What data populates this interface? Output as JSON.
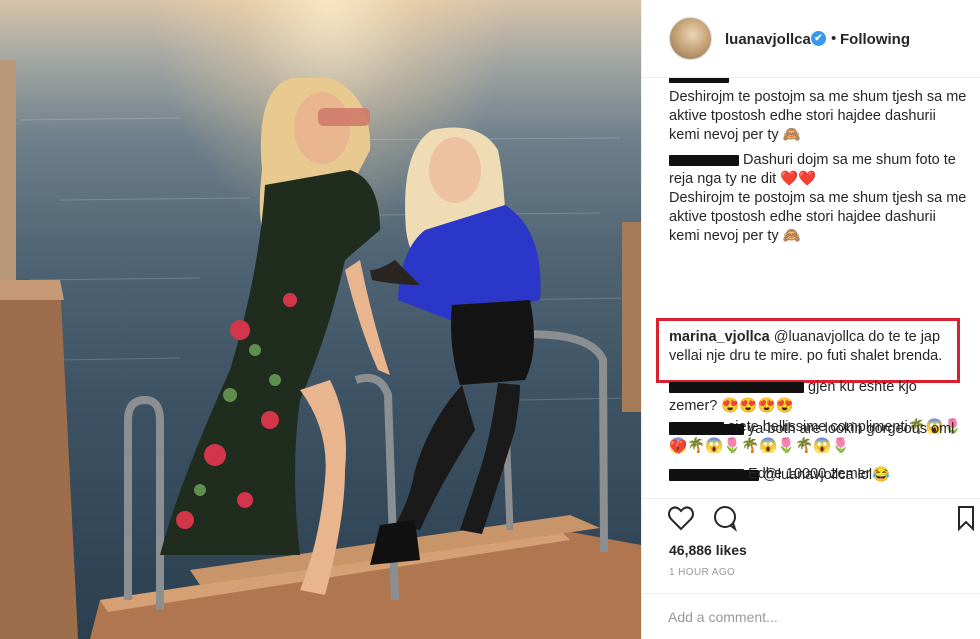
{
  "post": {
    "username": "luanavjollca",
    "verified_glyph": "✔",
    "dot": "•",
    "following_label": "Following"
  },
  "comments": [
    {
      "id": "c1",
      "user": "",
      "text": "Deshirojm te postojm sa me shum tjesh sa me aktive tpostosh edhe stori hajdee dashurii kemi nevoj per ty 🙈"
    },
    {
      "id": "c2",
      "user": "",
      "text": "Dashuri dojm sa me shum foto te reja nga ty ne dit ❤️❤️"
    },
    {
      "id": "c2b",
      "user": "",
      "text": "Deshirojm te postojm sa me shum tjesh sa me aktive tpostosh edhe stori hajdee dashurii kemi nevoj per ty 🙈"
    },
    {
      "id": "c3",
      "user": "marina_vjollca",
      "text": "@luanavjollca do te te jap vellai nje dru te mire. po futi shalet brenda."
    },
    {
      "id": "c4",
      "user": "",
      "text": "gjen ku eshte kjo zemer? 😍😍😍😍"
    },
    {
      "id": "c5",
      "user": "",
      "text": "siete bellissime complimenti🌴😱🌷 😱🌴😱🌷🌴😱🌷🌴😱🌷"
    },
    {
      "id": "c6",
      "user": "",
      "text": "@luanavjollca lol😂"
    },
    {
      "id": "c7",
      "user": "",
      "text": "ya both are lookin gorgeous oml💔"
    },
    {
      "id": "c8",
      "user": "",
      "text": "Edhe 10000 zemer"
    }
  ],
  "actions": {
    "likes": "46,886 likes",
    "time": "1 HOUR AGO",
    "add_comment_placeholder": "Add a comment..."
  },
  "icons": [
    "heart-icon",
    "comment-icon",
    "bookmark-icon",
    "verified-icon"
  ],
  "colors": {
    "highlight": "#d9202f",
    "verified": "#3897f0",
    "muted": "#999999"
  }
}
